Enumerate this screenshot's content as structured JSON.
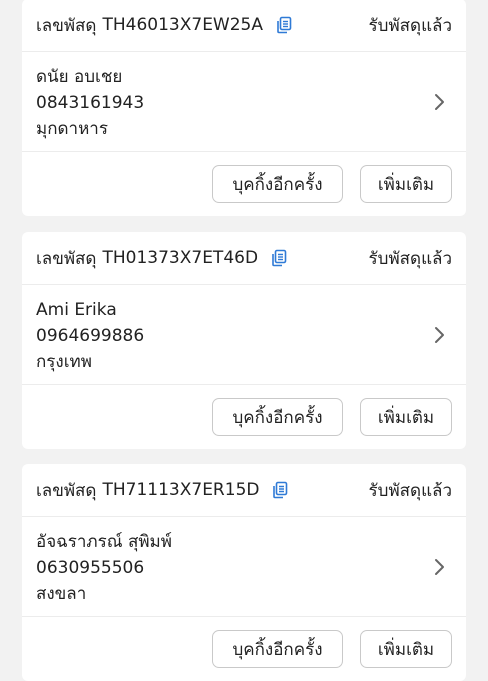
{
  "labels": {
    "tracking_prefix": "เลขพัสดุ",
    "rebook_button": "บุคกิ้งอีกครั้ง",
    "more_button": "เพิ่มเติม"
  },
  "icons": {
    "copy": "copy-icon",
    "chevron": "chevron-right-icon"
  },
  "colors": {
    "accent": "#2f7ad6"
  },
  "parcels": [
    {
      "tracking_number": "TH46013X7EW25A",
      "status": "รับพัสดุแล้ว",
      "name": "ดนัย อบเชย",
      "phone": "0843161943",
      "province": "มุกดาหาร"
    },
    {
      "tracking_number": "TH01373X7ET46D",
      "status": "รับพัสดุแล้ว",
      "name": "Ami Erika",
      "phone": "0964699886",
      "province": "กรุงเทพ"
    },
    {
      "tracking_number": "TH71113X7ER15D",
      "status": "รับพัสดุแล้ว",
      "name": "อัจฉราภรณ์ สุพิมพ์",
      "phone": "0630955506",
      "province": "สงขลา"
    }
  ]
}
